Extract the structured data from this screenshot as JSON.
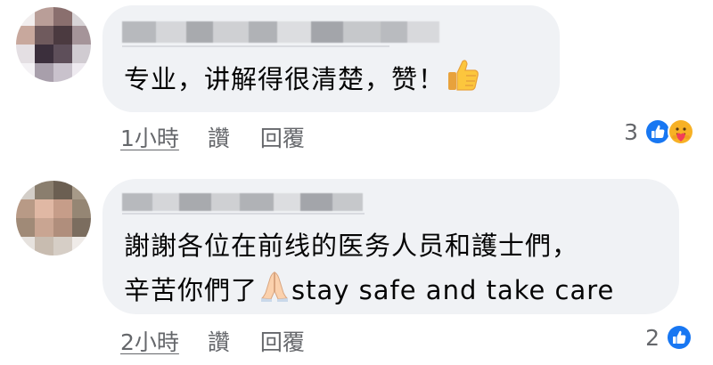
{
  "comments": [
    {
      "text": "专业，讲解得很清楚，赞！",
      "emoji": "thumbs-up",
      "time": "1小時",
      "like_label": "讚",
      "reply_label": "回覆",
      "reaction_count": "3",
      "reaction_icons": [
        "like-icon",
        "care-icon"
      ]
    },
    {
      "text_line1": "謝謝各位在前线的医务人员和護士們，",
      "text_line2_a": "辛苦你們了",
      "text_line2_b": "stay safe and take care",
      "emoji": "folded-hands",
      "time": "2小時",
      "like_label": "讚",
      "reply_label": "回覆",
      "reaction_count": "2",
      "reaction_icons": [
        "like-icon"
      ]
    }
  ],
  "colors": {
    "bubble": "#f0f2f5",
    "secondary_text": "#65676b",
    "like_blue": "#1877f2",
    "care_yellow": "#f7b125"
  }
}
